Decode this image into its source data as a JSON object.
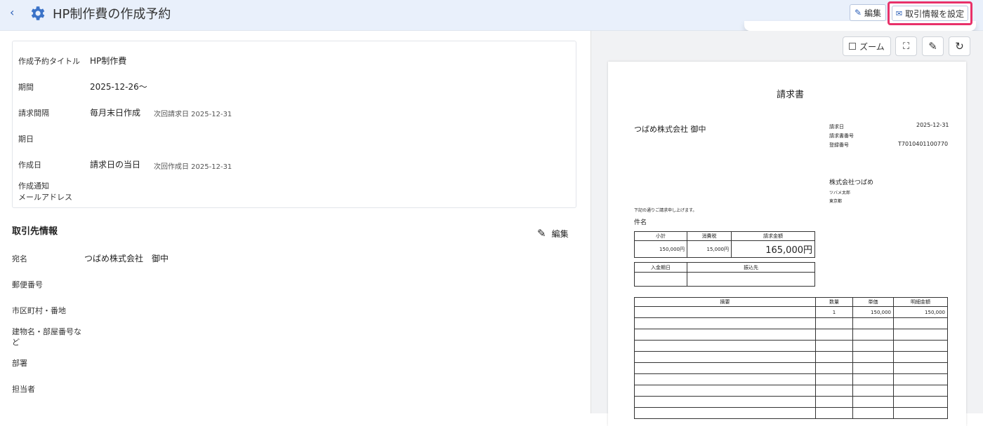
{
  "header": {
    "back": "‹",
    "title": "HP制作費の作成予約",
    "edit_label": "編集",
    "set_label": "取引情報を設定"
  },
  "schedule": {
    "title_label": "作成予約タイトル",
    "title_value": "HP制作費",
    "period_label": "期間",
    "period_value": "2025-12-26〜",
    "interval_label": "請求間隔",
    "interval_value": "毎月末日作成",
    "next_invoice": "次回請求日 2025-12-31",
    "due_label": "期日",
    "created_label": "作成日",
    "created_value": "請求日の当日",
    "next_created": "次回作成日 2025-12-31",
    "notify_label_1": "作成通知",
    "notify_label_2": "メールアドレス"
  },
  "client": {
    "section_title": "取引先情報",
    "edit_label": "編集",
    "name_label": "宛名",
    "name_value": "つばめ株式会社　御中",
    "postal_label": "郵便番号",
    "address_label": "市区町村・番地",
    "building_label_1": "建物名・部屋番号な",
    "building_label_2": "ど",
    "dept_label": "部署",
    "person_label": "担当者"
  },
  "preview": {
    "zoom_label": "ズーム",
    "doc_title": "請求書",
    "to": "つばめ株式会社 御中",
    "date_label": "請求日",
    "date_value": "2025-12-31",
    "number_label": "請求書番号",
    "reg_label": "登録番号",
    "reg_value": "T7010401100770",
    "issuer": "株式会社つばめ",
    "issuer_person": "ツバメ太郎",
    "issuer_address": "東京都",
    "message": "下記の通りご請求申し上げます。",
    "subject_label": "件名",
    "subtotal_label": "小計",
    "tax_label": "消費税",
    "total_label": "請求金額",
    "subtotal": "150,000円",
    "tax": "15,000円",
    "total": "165,000円",
    "due_date_label": "入金期日",
    "bank_label": "振込先",
    "item_desc_label": "摘要",
    "qty_label": "数量",
    "unit_label": "単価",
    "amount_label": "明細金額",
    "qty": "1",
    "unit_price": "150,000",
    "amount": "150,000"
  }
}
